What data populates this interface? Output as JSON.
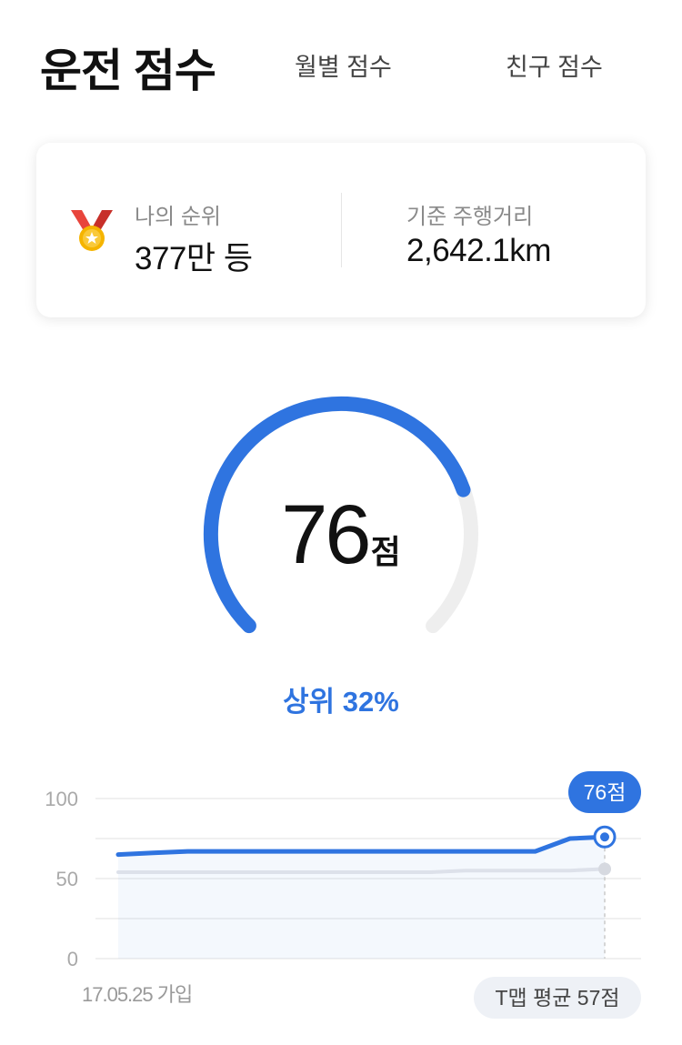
{
  "tabs": {
    "main": "운전 점수",
    "monthly": "월별 점수",
    "friends": "친구 점수"
  },
  "stats": {
    "rank_label": "나의 순위",
    "rank_value": "377만 등",
    "distance_label": "기준 주행거리",
    "distance_value": "2,642.1km"
  },
  "icons": {
    "medal": "medal-icon"
  },
  "score": {
    "value": "76",
    "unit": "점",
    "value_numeric": 76,
    "max": 100,
    "percentile": "상위 32%"
  },
  "colors": {
    "accent": "#2f74e0",
    "track": "#eeeeee",
    "avg_line": "#dde1ea"
  },
  "chart_data": {
    "type": "line",
    "ylim": [
      0,
      100
    ],
    "y_ticks": [
      "100",
      "50",
      "0"
    ],
    "x_start_label": "17.05.25 가입",
    "series": [
      {
        "values": [
          65,
          66,
          67,
          67,
          67,
          67,
          67,
          67,
          67,
          67,
          67,
          67,
          67,
          75,
          76
        ]
      },
      {
        "values": [
          54,
          54,
          54,
          54,
          54,
          54,
          54,
          54,
          54,
          54,
          55,
          55,
          55,
          55,
          56
        ]
      }
    ],
    "current_label": "76점",
    "average_label": "T맵 평균 57점"
  }
}
